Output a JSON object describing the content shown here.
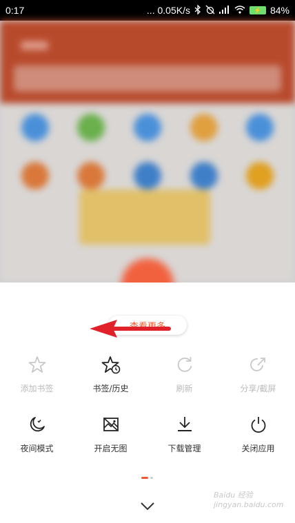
{
  "status_bar": {
    "time": "0:17",
    "network_speed": "... 0.05K/s",
    "battery_percent": "84%"
  },
  "colors": {
    "accent": "#ef5a32",
    "arrow": "#e0212a",
    "icon_active": "#222222",
    "icon_disabled": "#c8c8c8"
  },
  "sheet": {
    "view_more_label": "查看更多",
    "menu": [
      {
        "label": "添加书签",
        "icon": "star-icon",
        "enabled": false
      },
      {
        "label": "书签/历史",
        "icon": "star-clock-icon",
        "enabled": true
      },
      {
        "label": "刷新",
        "icon": "refresh-icon",
        "enabled": false
      },
      {
        "label": "分享/截屏",
        "icon": "share-icon",
        "enabled": false
      },
      {
        "label": "夜间模式",
        "icon": "moon-icon",
        "enabled": true
      },
      {
        "label": "开启无图",
        "icon": "no-image-icon",
        "enabled": true
      },
      {
        "label": "下载管理",
        "icon": "download-icon",
        "enabled": true
      },
      {
        "label": "关闭应用",
        "icon": "power-icon",
        "enabled": true
      }
    ],
    "pager": {
      "pages": 2,
      "current": 1
    }
  },
  "watermark": "Baidu 经验 jingyan.baidu.com"
}
